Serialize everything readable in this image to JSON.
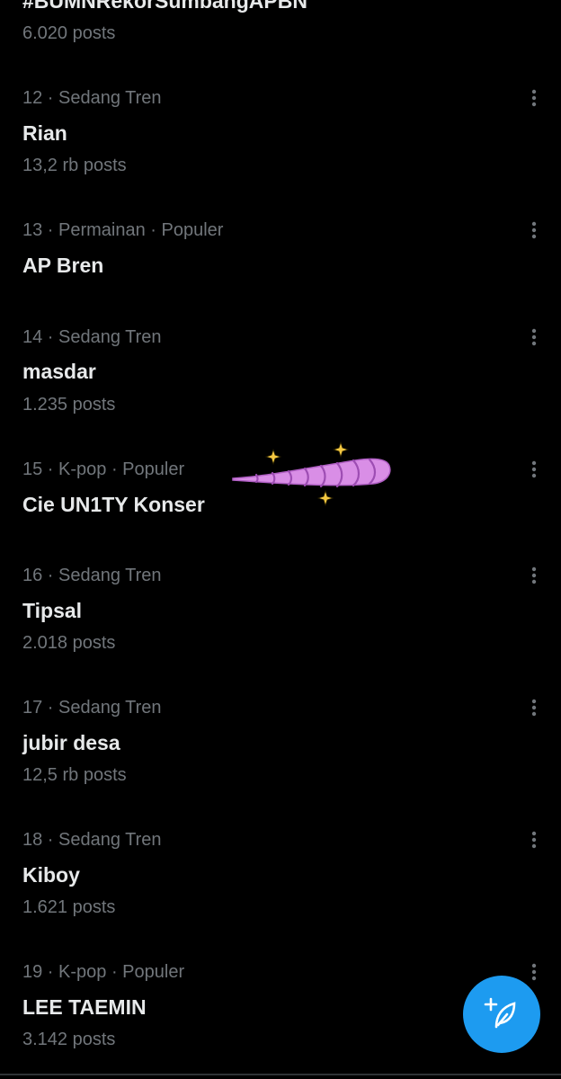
{
  "colors": {
    "background": "#000000",
    "text_primary": "#e7e9ea",
    "text_secondary": "#71767b",
    "accent": "#1d9bf0",
    "sticker_pink": "#d98ee6",
    "sparkle_yellow": "#f5c842"
  },
  "partial_top": {
    "title": "#BUMNRekorSumbangAPBN",
    "count": "6.020 posts"
  },
  "trends": [
    {
      "meta": "12 · Sedang Tren",
      "title": "Rian",
      "count": "13,2 rb posts"
    },
    {
      "meta": "13 · Permainan · Populer",
      "title": "AP Bren",
      "count": ""
    },
    {
      "meta": "14 · Sedang Tren",
      "title": "masdar",
      "count": "1.235 posts"
    },
    {
      "meta": "15 · K-pop · Populer",
      "title": "Cie UN1TY Konser",
      "count": ""
    },
    {
      "meta": "16 · Sedang Tren",
      "title": "Tipsal",
      "count": "2.018 posts"
    },
    {
      "meta": "17 · Sedang Tren",
      "title": "jubir desa",
      "count": "12,5 rb posts"
    },
    {
      "meta": "18 · Sedang Tren",
      "title": "Kiboy",
      "count": "1.621 posts"
    },
    {
      "meta": "19 · K-pop · Populer",
      "title": "LEE TAEMIN",
      "count": "3.142 posts"
    }
  ],
  "icons": {
    "more": "more-vertical-icon",
    "compose": "feather-plus-icon",
    "sticker": "sparkle-horn-sticker"
  }
}
